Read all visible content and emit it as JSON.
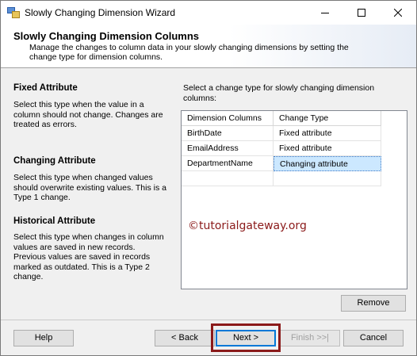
{
  "window": {
    "title": "Slowly Changing Dimension Wizard"
  },
  "header": {
    "title": "Slowly Changing Dimension Columns",
    "description": "Manage the changes to column data in your slowly changing dimensions by setting the change type for dimension columns."
  },
  "attributes": [
    {
      "title": "Fixed Attribute",
      "description": "Select this type when the value in a column should not change. Changes are treated as errors."
    },
    {
      "title": "Changing Attribute",
      "description": "Select this type when changed values should overwrite existing values. This is a Type 1 change."
    },
    {
      "title": "Historical Attribute",
      "description": "Select this type when changes in column values are saved in new records. Previous values are saved in records marked as outdated. This is a Type 2 change."
    }
  ],
  "grid": {
    "instruction": "Select a change type for slowly changing dimension columns:",
    "columns": [
      "Dimension Columns",
      "Change Type"
    ],
    "rows": [
      {
        "column": "BirthDate",
        "type": "Fixed attribute"
      },
      {
        "column": "EmailAddress",
        "type": "Fixed attribute"
      },
      {
        "column": "DepartmentName",
        "type": "Changing attribute"
      }
    ]
  },
  "buttons": {
    "remove": "Remove",
    "help": "Help",
    "back": "< Back",
    "next": "Next >",
    "finish": "Finish >>|",
    "cancel": "Cancel"
  },
  "watermark": "©tutorialgateway.org",
  "colors": {
    "selection": "#cce8ff",
    "highlight_border": "#8b1a1a",
    "default_button_border": "#0078d7"
  }
}
